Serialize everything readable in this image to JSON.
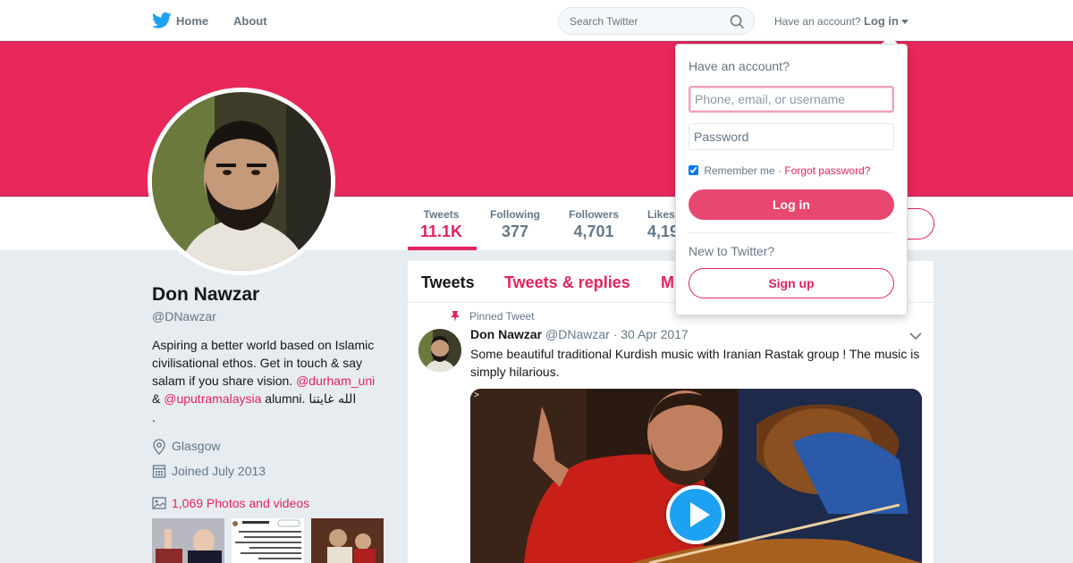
{
  "nav": {
    "home_label": "Home",
    "about_label": "About",
    "search_placeholder": "Search Twitter",
    "have_account": "Have an account?",
    "login_label": "Log in"
  },
  "profile": {
    "name": "Don Nawzar",
    "handle": "@DNawzar",
    "bio_text": "Aspiring a better world based on Islamic civilisational ethos. Get in touch & say salam if you share vision.",
    "bio_mention_1": "@durham_uni",
    "bio_amp": "&",
    "bio_mention_2": "@uputramalaysia",
    "bio_alumni": "alumni.",
    "bio_arabic": "الله غايتنا",
    "bio_trailing": ".",
    "location": "Glasgow",
    "joined": "Joined July 2013",
    "photos_label": "1,069 Photos and videos"
  },
  "stats": [
    {
      "label": "Tweets",
      "value": "11.1K"
    },
    {
      "label": "Following",
      "value": "377"
    },
    {
      "label": "Followers",
      "value": "4,701"
    },
    {
      "label": "Likes",
      "value": "4,19"
    }
  ],
  "timeline": {
    "tabs": [
      "Tweets",
      "Tweets & replies",
      "M"
    ],
    "pinned_label": "Pinned Tweet",
    "tweet": {
      "name": "Don Nawzar",
      "handle": "@DNawzar",
      "separator": "·",
      "date": "30 Apr 2017",
      "text": "Some beautiful traditional Kurdish music with Iranian Rastak group ! The music is simply hilarious.",
      "media_marker": ">"
    }
  },
  "login_dropdown": {
    "title": "Have an account?",
    "username_placeholder": "Phone, email, or username",
    "password_placeholder": "Password",
    "remember_label": "Remember me",
    "separator": "·",
    "forgot_label": "Forgot password?",
    "login_button": "Log in",
    "new_label": "New to Twitter?",
    "signup_button": "Sign up"
  },
  "colors": {
    "accent": "#e0245e",
    "banner": "#e8285a",
    "twitter_blue": "#1da1f2"
  },
  "icons": {
    "logo": "twitter-bird-icon",
    "search": "search-icon",
    "location": "location-pin-icon",
    "calendar": "calendar-icon",
    "photos": "photo-icon",
    "pinned": "pin-icon",
    "play": "play-icon"
  }
}
